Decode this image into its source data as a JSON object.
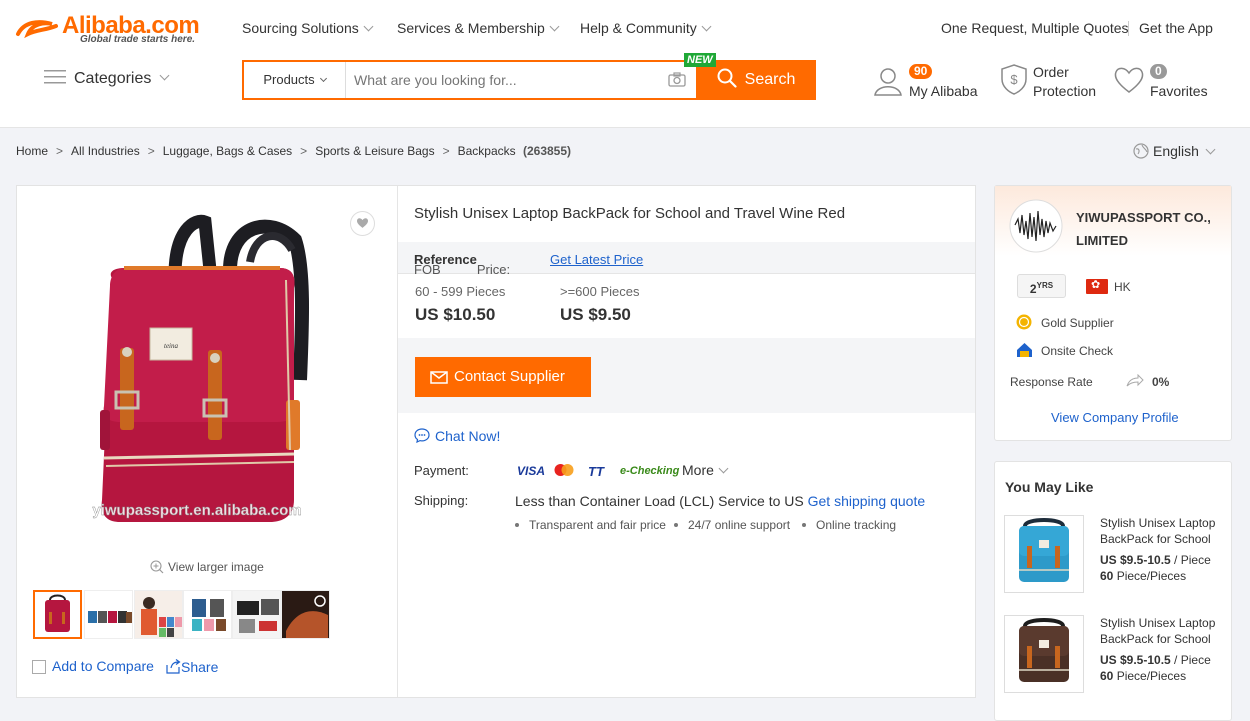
{
  "header": {
    "logo_text": "Alibaba.com",
    "logo_tagline": "Global trade starts here.",
    "nav": [
      "Sourcing Solutions",
      "Services & Membership",
      "Help & Community"
    ],
    "rfq_link": "One Request, Multiple Quotes",
    "app_link": "Get the App",
    "categories_label": "Categories",
    "search": {
      "category": "Products",
      "placeholder": "What are you looking for...",
      "button_label": "Search",
      "new_badge": "NEW"
    },
    "my_alibaba": {
      "label": "My Alibaba",
      "count": "90"
    },
    "order_protection": {
      "line1": "Order",
      "line2": "Protection"
    },
    "favorites": {
      "label": "Favorites",
      "count": "0"
    }
  },
  "breadcrumb": {
    "items": [
      "Home",
      "All Industries",
      "Luggage, Bags & Cases",
      "Sports & Leisure Bags",
      "Backpacks"
    ],
    "count": "(263855)"
  },
  "language": "English",
  "gallery": {
    "watermark": "yiwupassport.en.alibaba.com",
    "view_larger": "View larger image",
    "add_to_compare": "Add to Compare",
    "share": "Share",
    "patch_text": "teina"
  },
  "product": {
    "title": "Stylish Unisex Laptop BackPack for School and Travel Wine Red",
    "fob_prefix": "FOB",
    "fob_bold": "Reference",
    "fob_suffix": "Price:",
    "latest_price_link": "Get Latest Price",
    "tiers": [
      {
        "qty": "60 - 599 Pieces",
        "price": "US $10.50"
      },
      {
        "qty": ">=600 Pieces",
        "price": "US $9.50"
      }
    ],
    "contact_button": "Contact Supplier",
    "chat_link": "Chat Now!",
    "payment_label": "Payment:",
    "payment_methods": [
      "VISA",
      "TT",
      "e-Checking"
    ],
    "payment_more": "More",
    "shipping_label": "Shipping:",
    "shipping_text": "Less than Container Load (LCL) Service to US",
    "shipping_quote_link": "Get shipping quote",
    "shipping_features": [
      "Transparent and fair price",
      "24/7 online support",
      "Online tracking"
    ]
  },
  "supplier": {
    "name_line1": "YIWUPASSPORT CO.,",
    "name_line2": "LIMITED",
    "years": "2",
    "years_unit": "YRS",
    "region": "HK",
    "gold_supplier": "Gold Supplier",
    "onsite_check": "Onsite Check",
    "response_rate_label": "Response Rate",
    "response_rate_value": "0%",
    "profile_link": "View Company Profile"
  },
  "you_may_like": {
    "title": "You May Like",
    "items": [
      {
        "title": "Stylish Unisex Laptop BackPack for School",
        "price": "US $9.5-10.5",
        "unit": " / Piece",
        "moq": "60",
        "moq_unit": " Piece/Pieces"
      },
      {
        "title": "Stylish Unisex Laptop BackPack for School",
        "price": "US $9.5-10.5",
        "unit": " / Piece",
        "moq": "60",
        "moq_unit": " Piece/Pieces"
      }
    ]
  },
  "colors": {
    "accent": "#ff6a00",
    "link": "#1e62cc",
    "green_badge": "#1fa836",
    "product_red": "#b5163f"
  }
}
